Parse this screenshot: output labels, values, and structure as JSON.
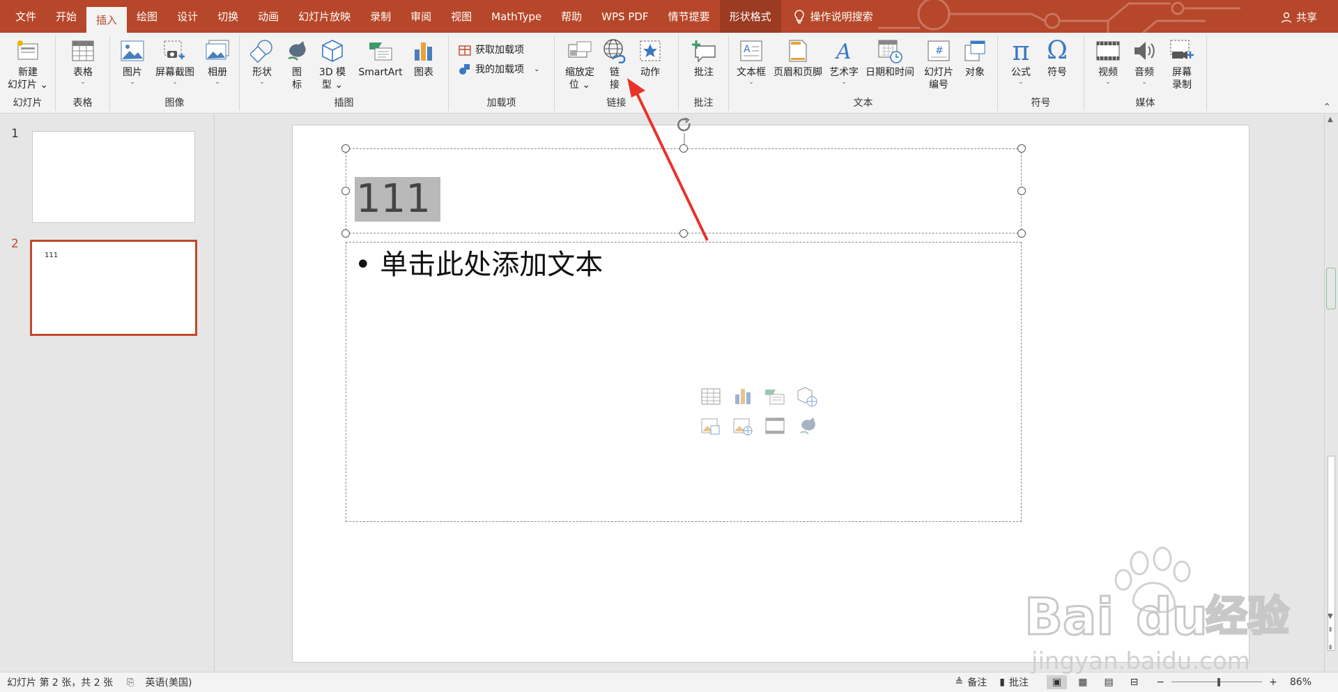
{
  "tabs": [
    {
      "label": "文件"
    },
    {
      "label": "开始"
    },
    {
      "label": "插入",
      "active": true
    },
    {
      "label": "绘图"
    },
    {
      "label": "设计"
    },
    {
      "label": "切换"
    },
    {
      "label": "动画"
    },
    {
      "label": "幻灯片放映"
    },
    {
      "label": "录制"
    },
    {
      "label": "审阅"
    },
    {
      "label": "视图"
    },
    {
      "label": "MathType"
    },
    {
      "label": "帮助"
    },
    {
      "label": "WPS PDF"
    },
    {
      "label": "情节提要"
    },
    {
      "label": "形状格式"
    }
  ],
  "tell_me": "操作说明搜索",
  "share": "共享",
  "ribbon": {
    "groups": {
      "slides": "幻灯片",
      "tables": "表格",
      "images": "图像",
      "illustrations": "插图",
      "addins": "加载项",
      "links": "链接",
      "comments": "批注",
      "text": "文本",
      "symbols": "符号",
      "media": "媒体"
    },
    "buttons": {
      "new_slide": [
        "新建",
        "幻灯片"
      ],
      "table": "表格",
      "picture": "图片",
      "screenshot": "屏幕截图",
      "album": "相册",
      "shapes": "形状",
      "icons": [
        "图",
        "标"
      ],
      "model3d": [
        "3D 模",
        "型"
      ],
      "smartart": "SmartArt",
      "chart": "图表",
      "get_addins": "获取加载项",
      "my_addins": "我的加载项",
      "zoom": [
        "缩放定",
        "位"
      ],
      "link": [
        "链",
        "接"
      ],
      "action": "动作",
      "comment": "批注",
      "textbox": "文本框",
      "header_footer": "页眉和页脚",
      "wordart": "艺术字",
      "datetime": "日期和时间",
      "slide_number": [
        "幻灯片",
        "编号"
      ],
      "object": "对象",
      "equation": "公式",
      "symbol": "符号",
      "video": "视频",
      "audio": "音频",
      "screen_record": [
        "屏幕",
        "录制"
      ]
    }
  },
  "thumbnails": [
    {
      "number": "1",
      "text": ""
    },
    {
      "number": "2",
      "text": "111"
    }
  ],
  "slide": {
    "title": "111",
    "body": "• 单击此处添加文本"
  },
  "status": {
    "slide_info": "幻灯片 第 2 张，共 2 张",
    "language": "英语(美国)",
    "notes": "备注",
    "comments": "批注",
    "zoom": "86%"
  },
  "watermark": {
    "brand": "Bai",
    "brand2": "du",
    "brand_cn": "经验",
    "url": "jingyan.baidu.com"
  },
  "colors": {
    "accent": "#b7472a",
    "arrow": "#e8332a"
  }
}
